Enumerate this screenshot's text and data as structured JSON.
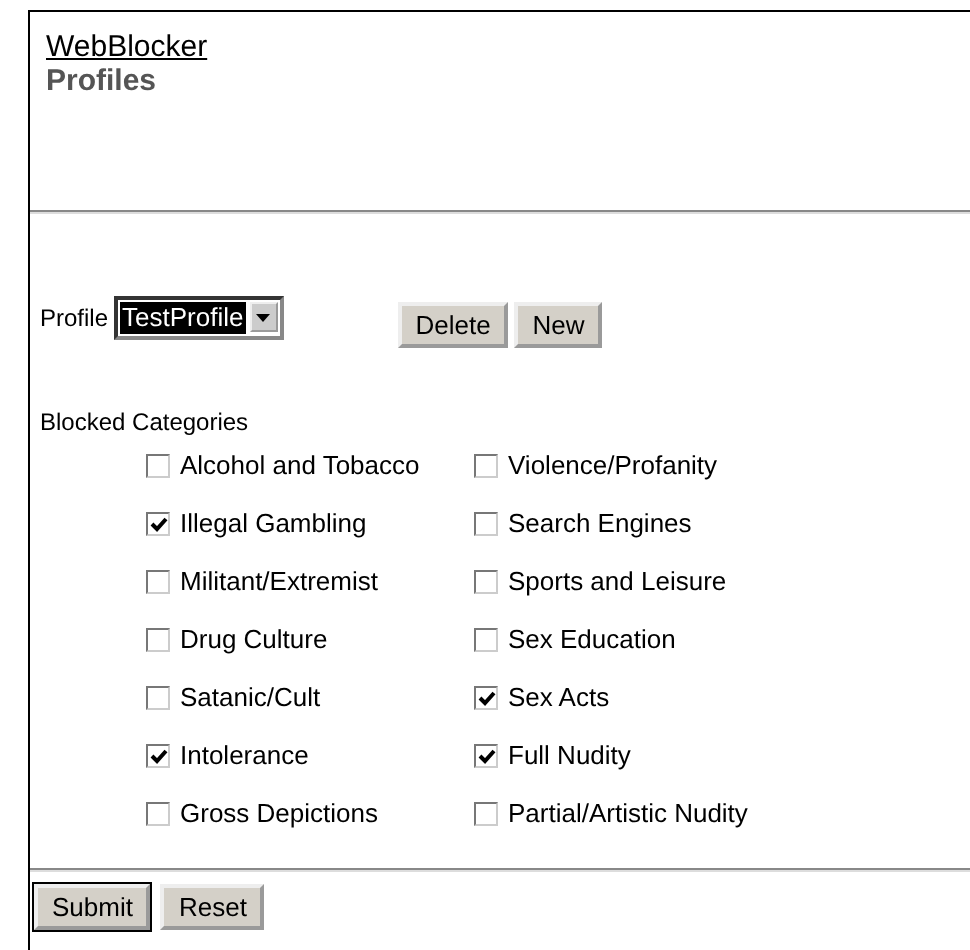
{
  "header": {
    "link": "WebBlocker",
    "title": "Profiles"
  },
  "profile": {
    "label": "Profile",
    "value": "TestProfile",
    "buttons": [
      "Delete",
      "New"
    ]
  },
  "blocked_categories": {
    "heading": "Blocked Categories",
    "items": [
      {
        "label": "Alcohol and Tobacco",
        "checked": false
      },
      {
        "label": "Violence/Profanity",
        "checked": false
      },
      {
        "label": "Illegal Gambling",
        "checked": true
      },
      {
        "label": "Search Engines",
        "checked": false
      },
      {
        "label": "Militant/Extremist",
        "checked": false
      },
      {
        "label": "Sports and Leisure",
        "checked": false
      },
      {
        "label": "Drug Culture",
        "checked": false
      },
      {
        "label": "Sex Education",
        "checked": false
      },
      {
        "label": "Satanic/Cult",
        "checked": false
      },
      {
        "label": "Sex Acts",
        "checked": true
      },
      {
        "label": "Intolerance",
        "checked": true
      },
      {
        "label": "Full Nudity",
        "checked": true
      },
      {
        "label": "Gross Depictions",
        "checked": false
      },
      {
        "label": "Partial/Artistic Nudity",
        "checked": false
      }
    ]
  },
  "footer_buttons": [
    "Submit",
    "Reset"
  ]
}
